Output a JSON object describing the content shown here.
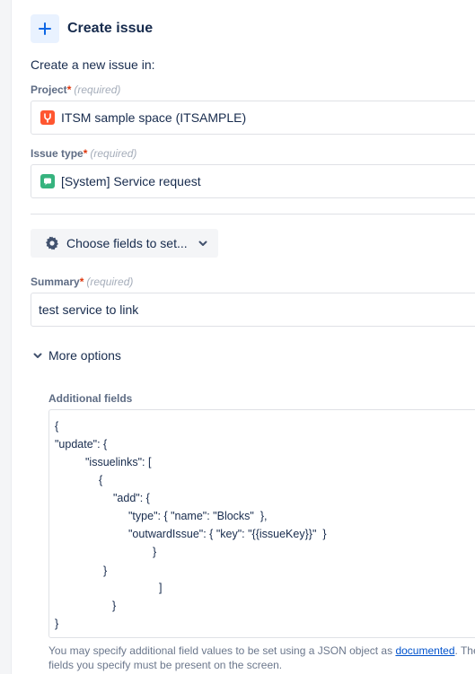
{
  "header": {
    "title": "Create issue",
    "plus_icon": "plus-icon"
  },
  "subtitle": "Create a new issue in:",
  "project": {
    "label": "Project",
    "required_mark": "*",
    "required_text": "(required)",
    "value": "ITSM sample space (ITSAMPLE)",
    "icon": "project-avatar-icon",
    "icon_color": "#ff5630"
  },
  "issue_type": {
    "label": "Issue type",
    "required_mark": "*",
    "required_text": "(required)",
    "value": "[System] Service request",
    "icon": "service-request-icon",
    "icon_color": "#36b37e"
  },
  "choose_fields": {
    "label": "Choose fields to set...",
    "icon": "gear-icon"
  },
  "summary": {
    "label": "Summary",
    "required_mark": "*",
    "required_text": "(required)",
    "value": "test service to link"
  },
  "more_options": {
    "label": "More options"
  },
  "additional_fields": {
    "label": "Additional fields",
    "lines": [
      "{",
      "\"update\": {",
      "\"issuelinks\": [",
      "{",
      "\"add\": {",
      "\"type\": { \"name\": \"Blocks\"  },",
      "\"outwardIssue\": { \"key\": \"{{issueKey}}\"  }",
      "}",
      "}",
      "]",
      "}",
      "}"
    ]
  },
  "help": {
    "before": "You may specify additional field values to be set using a JSON object as ",
    "link": "documented",
    "after": ". The fields you specify must be present on the screen."
  },
  "colors": {
    "accent": "#0052cc",
    "required": "#de350b",
    "text": "#172b4d"
  }
}
